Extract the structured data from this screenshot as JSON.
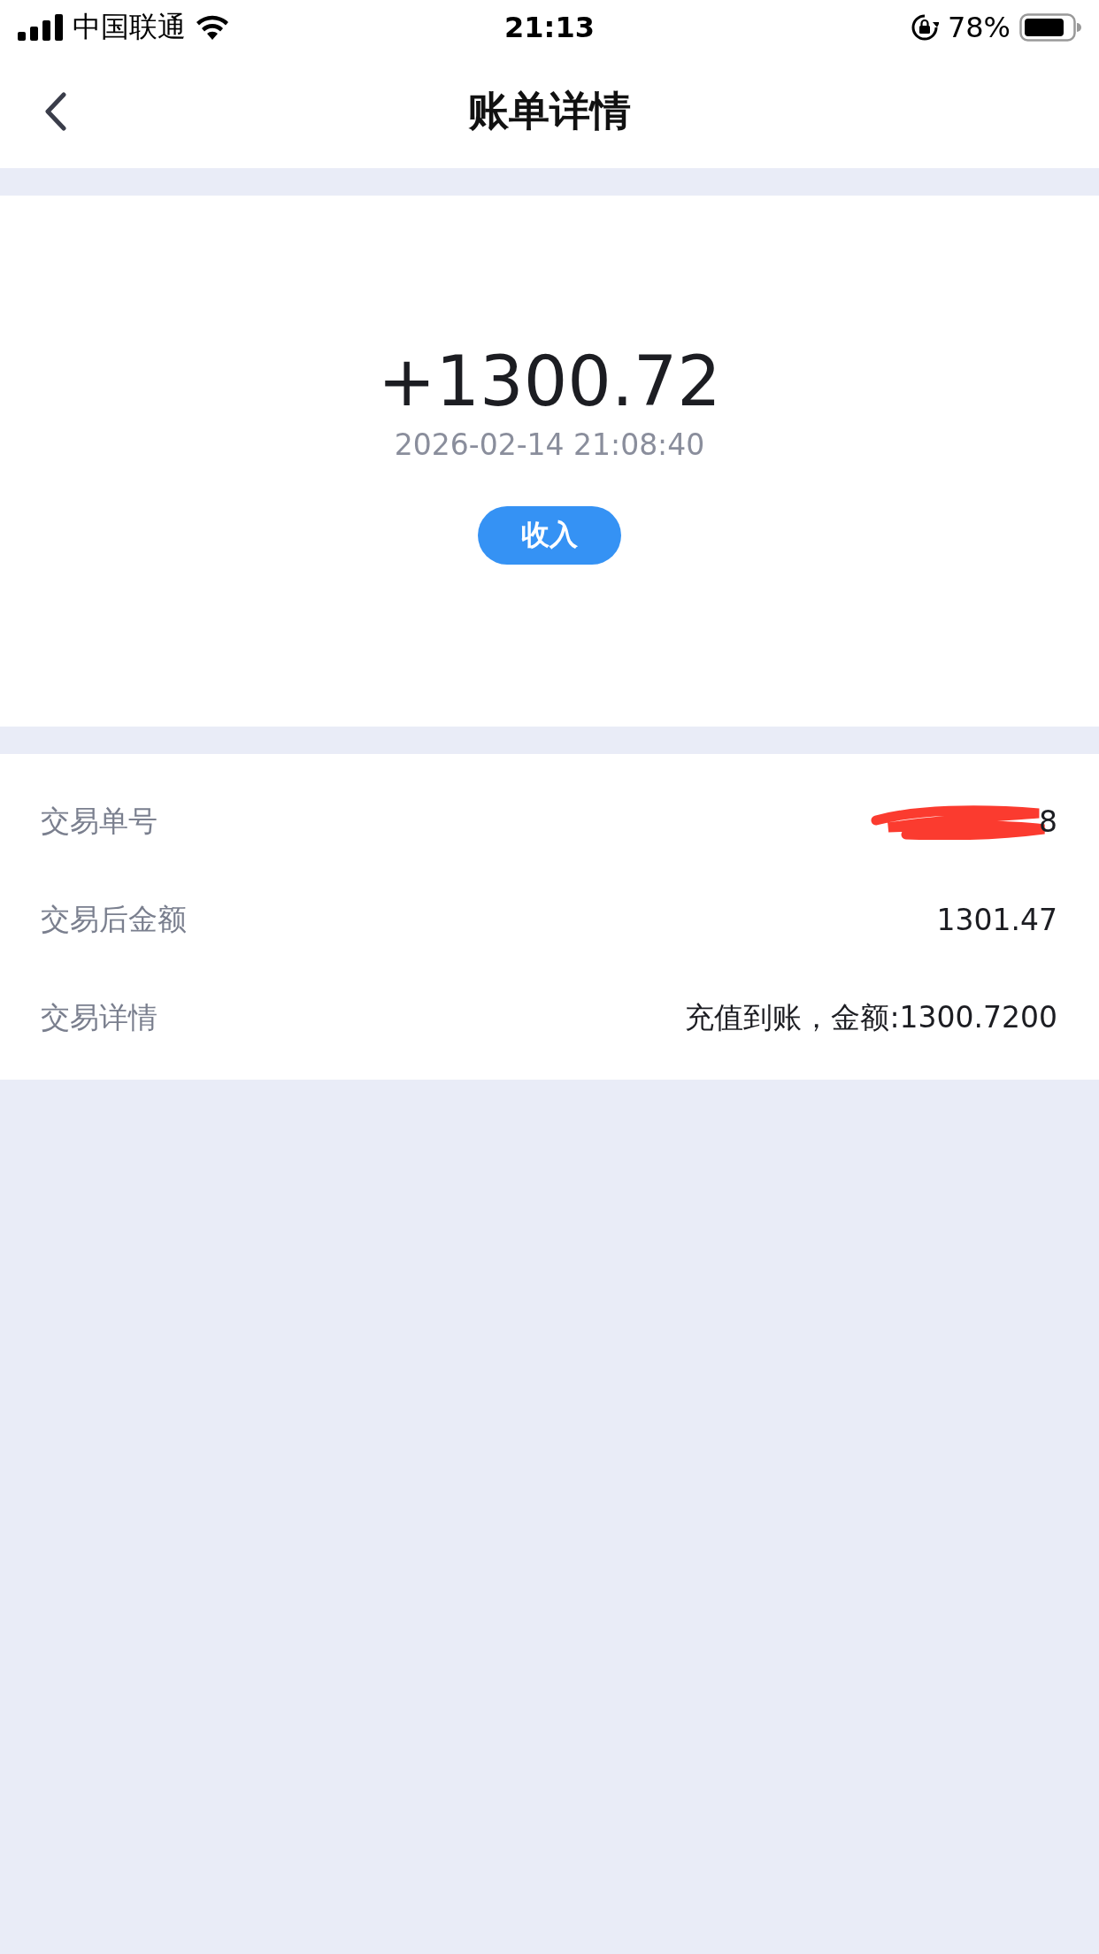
{
  "status_bar": {
    "carrier": "中国联通",
    "time": "21:13",
    "battery": "78%"
  },
  "nav": {
    "title": "账单详情"
  },
  "summary": {
    "amount": "+1300.72",
    "datetime": "2026-02-14 21:08:40",
    "type_badge": "收入"
  },
  "details": [
    {
      "label": "交易单号",
      "value": "8",
      "redacted": true
    },
    {
      "label": "交易后金额",
      "value": "1301.47",
      "redacted": false
    },
    {
      "label": "交易详情",
      "value": "充值到账，金额:1300.7200",
      "redacted": false
    }
  ]
}
